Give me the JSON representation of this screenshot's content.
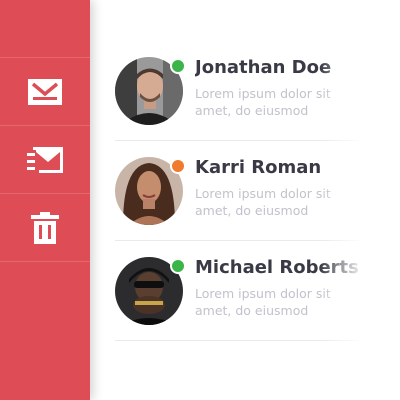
{
  "sidebar": {
    "items": [
      {
        "icon": "envelope-icon"
      },
      {
        "icon": "send-mail-icon"
      },
      {
        "icon": "trash-icon"
      }
    ]
  },
  "contacts": [
    {
      "name": "Jonathan Doe",
      "preview": "Lorem ipsum dolor sit amet, do eiusmod tempor incididunt",
      "status_color": "#3bb54a"
    },
    {
      "name": "Karri Roman",
      "preview": "Lorem ipsum dolor sit amet, do eiusmod tempor incididunt",
      "status_color": "#f07a2d"
    },
    {
      "name": "Michael Roberts",
      "preview": "Lorem ipsum dolor sit amet, do eiusmod tempor incididunt",
      "status_color": "#3bb54a"
    }
  ],
  "colors": {
    "sidebar_bg": "#de4c55",
    "name_text": "#3a3a46",
    "preview_text": "#c2c2cc"
  }
}
